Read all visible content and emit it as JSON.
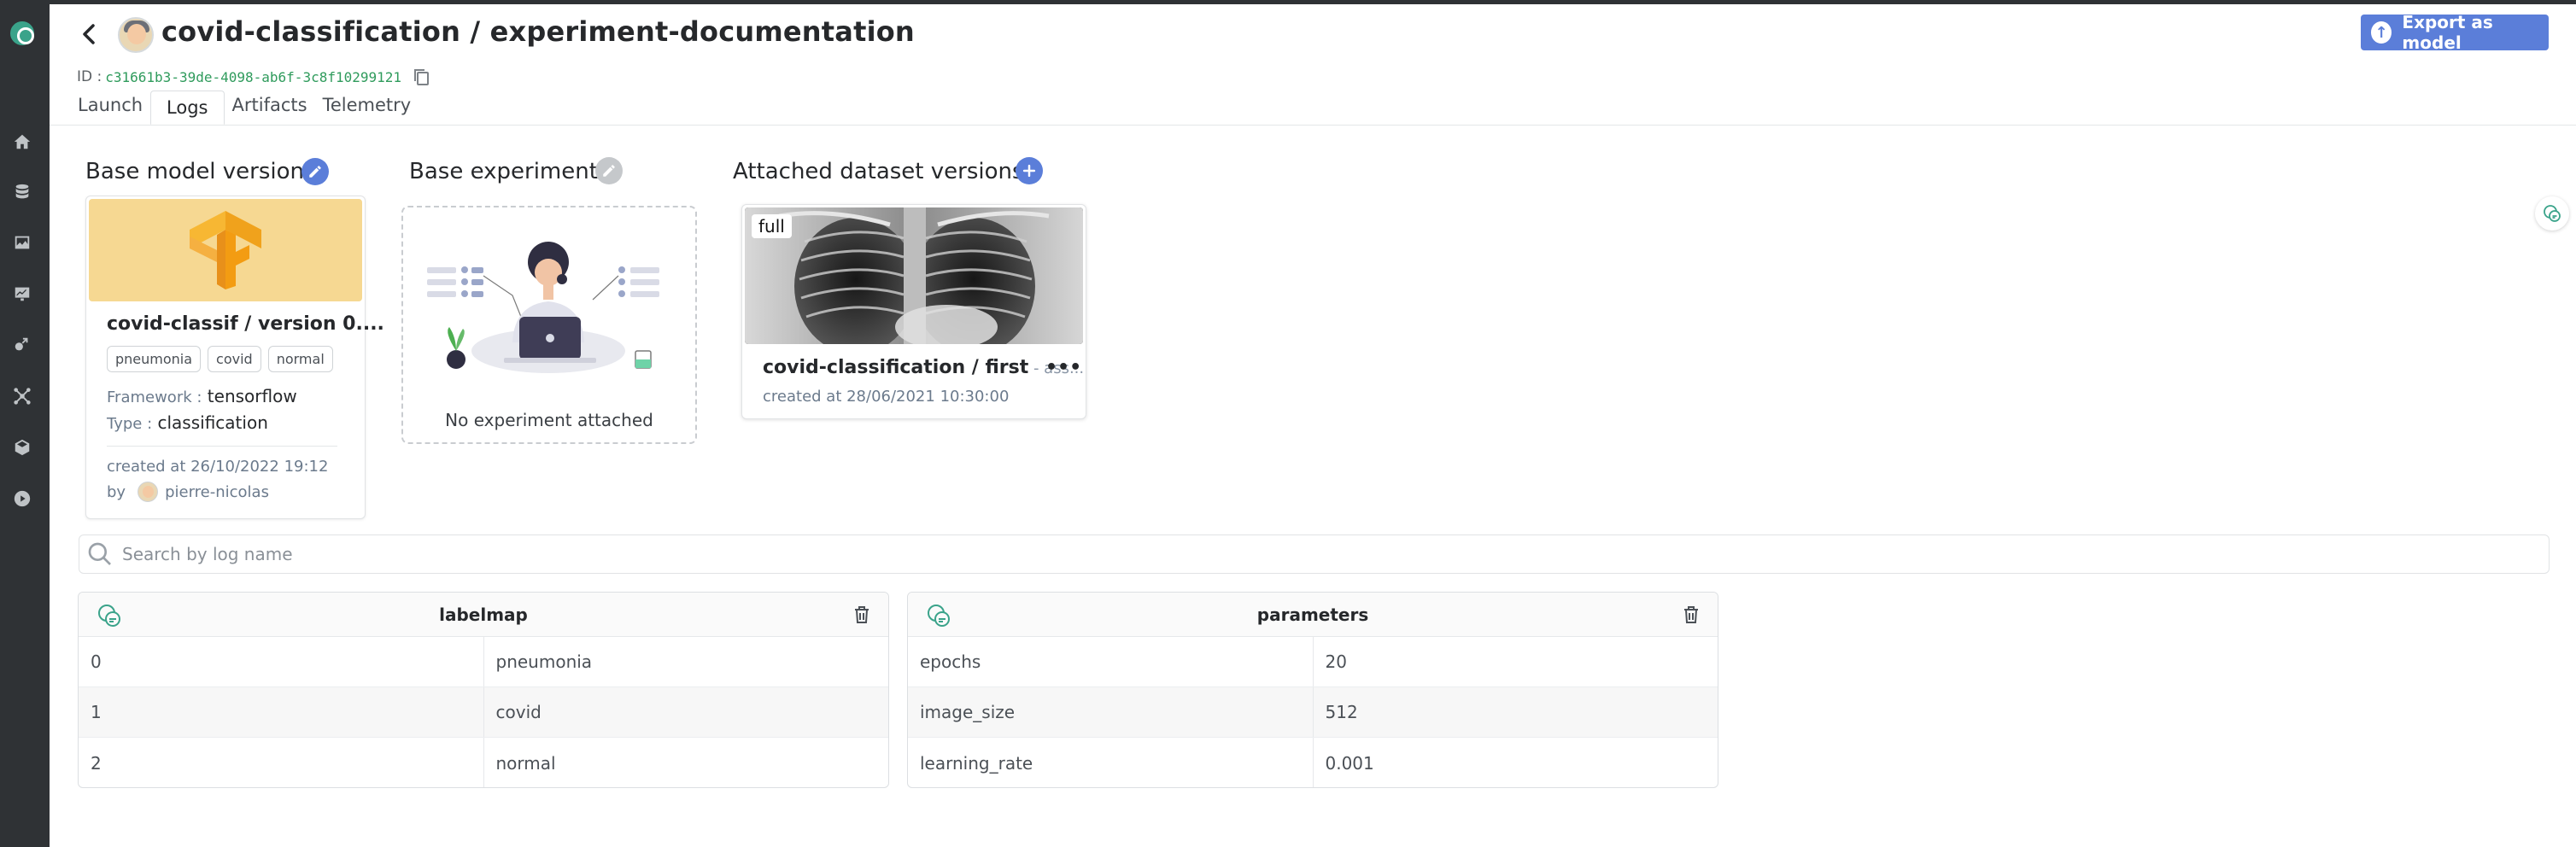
{
  "header": {
    "title": "covid-classification / experiment-documentation",
    "id_label": "ID :",
    "id_value": "c31661b3-39de-4098-ab6f-3c8f10299121",
    "export_label": "Export as model"
  },
  "tabs": [
    {
      "label": "Launch"
    },
    {
      "label": "Logs",
      "active": true
    },
    {
      "label": "Artifacts"
    },
    {
      "label": "Telemetry"
    }
  ],
  "sidebar": {
    "icons": [
      "home-icon",
      "datalake-icon",
      "datasets-icon",
      "projects-icon",
      "models-icon",
      "deployments-icon",
      "registry-icon",
      "processing-icon"
    ]
  },
  "base_model": {
    "section_title": "Base model version",
    "name": "covid-classif / version 0....",
    "tags": [
      "pneumonia",
      "covid",
      "normal"
    ],
    "framework_label": "Framework :",
    "framework": "tensorflow",
    "type_label": "Type :",
    "type": "classification",
    "created": "created at 26/10/2022 19:12",
    "by_label": "by",
    "author": "pierre-nicolas"
  },
  "base_experiment": {
    "section_title": "Base experiment",
    "empty_text": "No experiment attached"
  },
  "datasets": {
    "section_title": "Attached dataset versions",
    "badge": "full",
    "name": "covid-classification / first",
    "sub": " - ass...",
    "created": "created at 28/06/2021 10:30:00"
  },
  "search": {
    "placeholder": "Search by log name"
  },
  "logs": [
    {
      "title": "labelmap",
      "rows": [
        [
          "0",
          "pneumonia"
        ],
        [
          "1",
          "covid"
        ],
        [
          "2",
          "normal"
        ]
      ]
    },
    {
      "title": "parameters",
      "rows": [
        [
          "epochs",
          "20"
        ],
        [
          "image_size",
          "512"
        ],
        [
          "learning_rate",
          "0.001"
        ]
      ]
    }
  ],
  "colors": {
    "accent": "#5b7ed9",
    "brand": "#3aa38a",
    "sidebar": "#2f3235",
    "model_banner": "#f6d892"
  }
}
